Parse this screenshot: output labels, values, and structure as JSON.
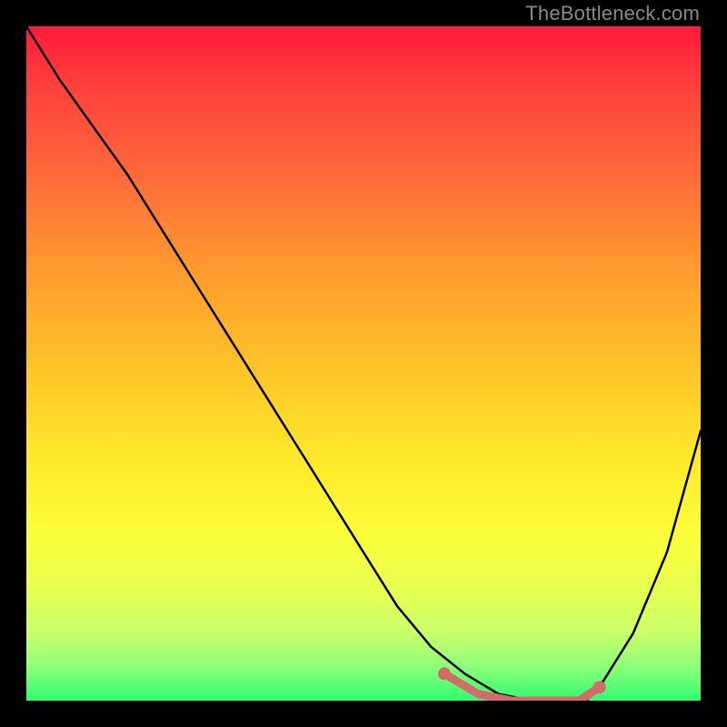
{
  "watermark": "TheBottleneck.com",
  "chart_data": {
    "type": "line",
    "title": "",
    "xlabel": "",
    "ylabel": "",
    "xlim": [
      0,
      100
    ],
    "ylim": [
      0,
      100
    ],
    "series": [
      {
        "name": "curve",
        "x": [
          0,
          5,
          10,
          15,
          20,
          25,
          30,
          35,
          40,
          45,
          50,
          55,
          60,
          65,
          70,
          75,
          80,
          83,
          85,
          90,
          95,
          100
        ],
        "y": [
          100,
          92,
          85,
          78,
          70,
          62,
          54,
          46,
          38,
          30,
          22,
          14,
          8,
          4,
          1,
          0,
          0,
          0,
          2,
          10,
          22,
          40
        ]
      }
    ],
    "highlight": {
      "color": "#d46a6a",
      "segments": [
        {
          "x": [
            62,
            67,
            72,
            77,
            82,
            85
          ],
          "y": [
            4,
            1,
            0,
            0,
            0,
            2
          ]
        }
      ],
      "dots": [
        {
          "x": 62,
          "y": 4
        },
        {
          "x": 85,
          "y": 2
        }
      ]
    }
  }
}
